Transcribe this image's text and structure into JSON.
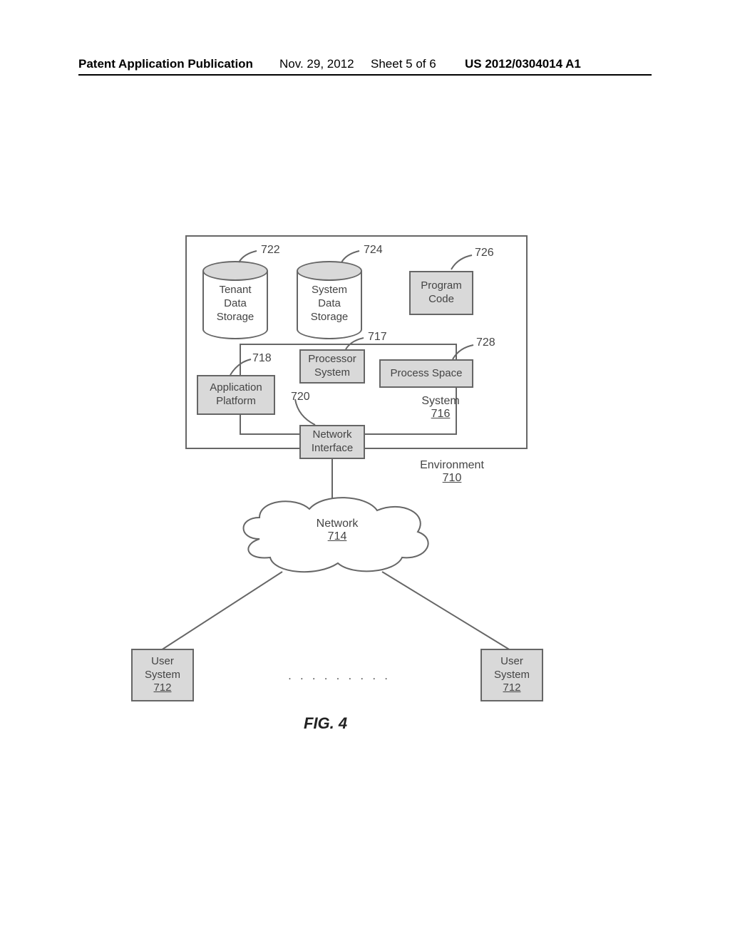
{
  "header": {
    "publication_label": "Patent Application Publication",
    "date": "Nov. 29, 2012",
    "sheet": "Sheet 5 of 6",
    "pub_number": "US 2012/0304014 A1"
  },
  "refs": {
    "tenant_storage": "722",
    "system_storage": "724",
    "program_code": "726",
    "processor_system": "717",
    "process_space": "728",
    "application_platform": "718",
    "network_interface": "720",
    "system": "716",
    "environment": "710",
    "network": "714",
    "user_system": "712"
  },
  "blocks": {
    "tenant_storage_l1": "Tenant",
    "tenant_storage_l2": "Data",
    "tenant_storage_l3": "Storage",
    "system_storage_l1": "System",
    "system_storage_l2": "Data",
    "system_storage_l3": "Storage",
    "program_code_l1": "Program",
    "program_code_l2": "Code",
    "processor_l1": "Processor",
    "processor_l2": "System",
    "process_space": "Process Space",
    "application_l1": "Application",
    "application_l2": "Platform",
    "network_if_l1": "Network",
    "network_if_l2": "Interface",
    "system_label": "System",
    "environment_label": "Environment",
    "network_label": "Network",
    "user_system_l1": "User",
    "user_system_l2": "System"
  },
  "caption": "FIG. 4",
  "ellipsis": ". . . . . . . . ."
}
